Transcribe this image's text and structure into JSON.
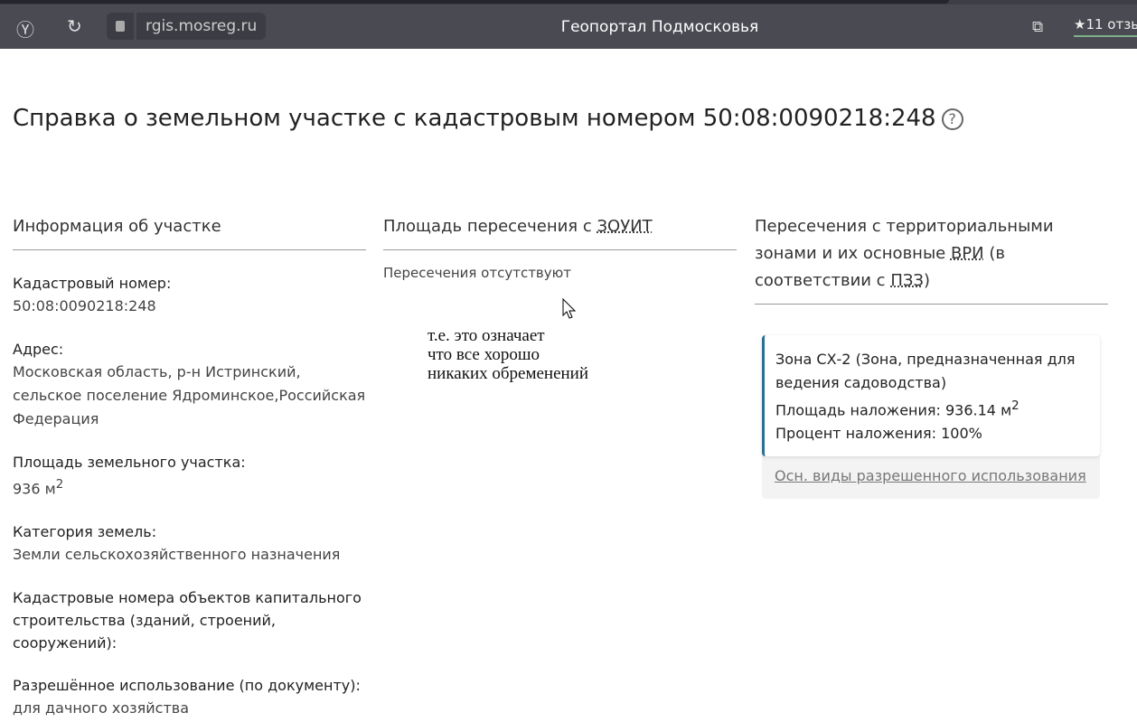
{
  "browser": {
    "url": "rgis.mosreg.ru",
    "title": "Геопортал Подмосковья",
    "reviews": "★11 отзы"
  },
  "page": {
    "title": "Справка о земельном участке с кадастровым номером 50:08:0090218:248",
    "help": "?"
  },
  "info": {
    "heading": "Информация об участке",
    "fields": [
      {
        "label": "Кадастровый номер:",
        "value": "50:08:0090218:248"
      },
      {
        "label": "Адрес:",
        "value": "Московская область, р-н Истринский, сельское поселение Ядроминское,Российская Федерация"
      },
      {
        "label": "Площадь земельного участка:",
        "value": "936 м",
        "sup": "2"
      },
      {
        "label": "Категория земель:",
        "value": "Земли сельскохозяйственного назначения"
      },
      {
        "label": "Кадастровые номера объектов капитального строительства (зданий, строений, сооружений):",
        "value": ""
      },
      {
        "label": "Разрешённое использование (по документу):",
        "value": "для дачного хозяйства"
      }
    ]
  },
  "zouit": {
    "heading_prefix": "Площадь пересечения с ",
    "heading_abbr": "ЗОУИТ",
    "empty": "Пересечения отсутствуют"
  },
  "annotation": {
    "lines": [
      "т.е. это означает",
      "что все хорошо",
      "никаких обременений"
    ]
  },
  "zones": {
    "heading_1": "Пересечения с территориальными зонами и их основные ",
    "abbr_1": "ВРИ",
    "heading_2": " (в соответствии с ",
    "abbr_2": "ПЗЗ",
    "heading_3": ")",
    "card": {
      "name": "Зона СХ-2 (Зона, предназначенная для ведения садоводства)",
      "area": "Площадь наложения: 936.14 м",
      "area_sup": "2",
      "percent": "Процент наложения: 100%"
    },
    "link": "Осн. виды разрешенного использования"
  },
  "colors": {
    "accent": "#2a6f96",
    "browser_bar": "#494a52"
  }
}
